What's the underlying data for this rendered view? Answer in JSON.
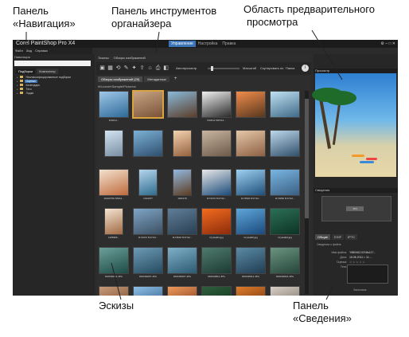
{
  "callouts": {
    "nav_panel": [
      "Панель",
      "«Навигация»"
    ],
    "organizer_toolbar": [
      "Панель инструментов",
      "органайзера"
    ],
    "preview_area": [
      "Область предварительного",
      "просмотра"
    ],
    "thumbnails": [
      "Эскизы"
    ],
    "info_panel": [
      "Панель",
      "«Сведения»"
    ]
  },
  "app": {
    "title": "Corel PaintShop Pro X4",
    "mode_tabs": [
      "Управление",
      "Настройка",
      "Правка"
    ],
    "active_mode": "Управление",
    "menu": [
      "Файл",
      "Вид",
      "Справка"
    ],
    "nav_panel": {
      "header": "Навигация",
      "search_placeholder": "",
      "tabs": [
        "Подборки",
        "Компьютер"
      ],
      "tree": [
        {
          "label": "Неклассифицированные подборки",
          "selected": false
        },
        {
          "label": "Оценки",
          "selected": true
        },
        {
          "label": "Календарь",
          "selected": false
        },
        {
          "label": "Теги",
          "selected": false
        },
        {
          "label": "Лодки",
          "selected": false
        }
      ]
    },
    "center": {
      "top_tabs": [
        "Эскизы",
        "Обзоры изображений"
      ],
      "toolbar": {
        "autopreview_label": "Автопросмотр",
        "size_label": "Масштаб",
        "sort_label": "Сортировать по",
        "sort_value": "Папка"
      },
      "doc_tabs": [
        "Обзоры изображений (29)",
        "Метаданные"
      ],
      "path": "\\b\\Leonie\\Sample\\Pictures\\",
      "thumbs": [
        {
          "cap": "4/30/14...",
          "colors": [
            "#9fc7e8",
            "#2e6a98"
          ],
          "portrait": false,
          "sel": false
        },
        {
          "cap": "",
          "colors": [
            "#c7a585",
            "#7a5236"
          ],
          "portrait": false,
          "sel": true
        },
        {
          "cap": "",
          "colors": [
            "#89b9d9",
            "#5b3d2a"
          ],
          "portrait": false,
          "sel": false
        },
        {
          "cap": "5/03/11 5/05/14...",
          "colors": [
            "#f0f0f0",
            "#2a2a2a"
          ],
          "portrait": false,
          "sel": false
        },
        {
          "cap": "",
          "colors": [
            "#f28c4b",
            "#57371e"
          ],
          "portrait": false,
          "sel": false
        },
        {
          "cap": "",
          "colors": [
            "#bfe2f2",
            "#406a89"
          ],
          "portrait": false,
          "sel": false
        },
        {
          "cap": "",
          "colors": [
            "#d3e4f1",
            "#7a8fa4"
          ],
          "portrait": true,
          "sel": false
        },
        {
          "cap": "",
          "colors": [
            "#7cb1d7",
            "#2e4e6d"
          ],
          "portrait": false,
          "sel": false
        },
        {
          "cap": "",
          "colors": [
            "#f3d2b0",
            "#95623e"
          ],
          "portrait": true,
          "sel": false
        },
        {
          "cap": "",
          "colors": [
            "#c9b5a0",
            "#6c5a4a"
          ],
          "portrait": false,
          "sel": false
        },
        {
          "cap": "",
          "colors": [
            "#e5c8a9",
            "#8d5f42"
          ],
          "portrait": false,
          "sel": false
        },
        {
          "cap": "",
          "colors": [
            "#bdd8ea",
            "#324f6c"
          ],
          "portrait": false,
          "sel": false
        },
        {
          "cap": "1610276S 5/9/12...",
          "colors": [
            "#f3e2cf",
            "#bf6a3c"
          ],
          "portrait": false,
          "sel": false
        },
        {
          "cap": "1313077",
          "colors": [
            "#b5d6ef",
            "#2f6b8c"
          ],
          "portrait": true,
          "sel": false
        },
        {
          "cap": "1181178",
          "colors": [
            "#93b8df",
            "#5c3d22"
          ],
          "portrait": true,
          "sel": false
        },
        {
          "cap": "1174372 5/17/12...",
          "colors": [
            "#e8e8e8",
            "#1b4b7a"
          ],
          "portrait": false,
          "sel": false
        },
        {
          "cap": "1174532 5/17/12...",
          "colors": [
            "#9dd0f1",
            "#1f4f79"
          ],
          "portrait": false,
          "sel": false
        },
        {
          "cap": "1174952 5/17/12...",
          "colors": [
            "#79b6e3",
            "#3b5f82"
          ],
          "portrait": false,
          "sel": false
        },
        {
          "cap": "1165995...",
          "colors": [
            "#f4e4d2",
            "#a06a42"
          ],
          "portrait": true,
          "sel": false
        },
        {
          "cap": "1174372 5/17/12...",
          "colors": [
            "#7fa5c7",
            "#3b4f61"
          ],
          "portrait": false,
          "sel": false
        },
        {
          "cap": "1174522 5/17/12...",
          "colors": [
            "#5f7e98",
            "#2a3f52"
          ],
          "portrait": false,
          "sel": false
        },
        {
          "cap": "Crystal01.jpg",
          "colors": [
            "#f36c1f",
            "#8c2b0c"
          ],
          "portrait": false,
          "sel": false
        },
        {
          "cap": "Crystal02.jpg",
          "colors": [
            "#5ea6d9",
            "#1b4a7c"
          ],
          "portrait": false,
          "sel": false
        },
        {
          "cap": "Crystal04.jpg",
          "colors": [
            "#2c6f56",
            "#0d3325"
          ],
          "portrait": false,
          "sel": false
        },
        {
          "cap": "DMC00001.JPG",
          "colors": [
            "#6aa09a",
            "#1f4b46"
          ],
          "portrait": false,
          "sel": false
        },
        {
          "cap": "DMC00007.JPG",
          "colors": [
            "#6f9bb6",
            "#234a5f"
          ],
          "portrait": false,
          "sel": false
        },
        {
          "cap": "DMC00007.JPG",
          "colors": [
            "#7fb0c9",
            "#2b5a71"
          ],
          "portrait": false,
          "sel": false
        },
        {
          "cap": "DMC00011.JPG",
          "colors": [
            "#4f7b6e",
            "#1d3a32"
          ],
          "portrait": false,
          "sel": false
        },
        {
          "cap": "DMC00012.JPG",
          "colors": [
            "#5b8aa5",
            "#203d52"
          ],
          "portrait": false,
          "sel": false
        },
        {
          "cap": "DMC00016.JPG",
          "colors": [
            "#6b9480",
            "#25453a"
          ],
          "portrait": false,
          "sel": false
        },
        {
          "cap": "",
          "colors": [
            "#c89a76",
            "#6a3e25"
          ],
          "portrait": false,
          "sel": false
        },
        {
          "cap": "",
          "colors": [
            "#8fc0e6",
            "#1e4c7a"
          ],
          "portrait": false,
          "sel": false
        },
        {
          "cap": "",
          "colors": [
            "#f09a5a",
            "#6a2a10"
          ],
          "portrait": false,
          "sel": false
        },
        {
          "cap": "",
          "colors": [
            "#2d5f3c",
            "#0f2b1a"
          ],
          "portrait": false,
          "sel": false
        },
        {
          "cap": "",
          "colors": [
            "#e07b2a",
            "#5a2a0c"
          ],
          "portrait": false,
          "sel": false
        },
        {
          "cap": "",
          "colors": [
            "#d8d0c8",
            "#6b5f54"
          ],
          "portrait": false,
          "sel": false
        }
      ]
    },
    "right": {
      "preview_header": "Просмотр",
      "navigator_header": "Сведения",
      "navigator_box": "JPG",
      "info_tabs": [
        "Общие",
        "EXIF",
        "IPTC"
      ],
      "active_info_tab": "Общие",
      "info_section": "Сведения о файле",
      "info_rows": [
        {
          "k": "Имя файла:",
          "v": "Y880462-02Ч6к117..."
        },
        {
          "k": "Дата:",
          "v": "16.06.2011 г. 11:..."
        },
        {
          "k": "Оценка:",
          "v": "☆☆☆☆☆"
        },
        {
          "k": "Теги:",
          "v": "Введите здесь..."
        }
      ],
      "bottom_label": "Заголовок"
    }
  },
  "colors": {
    "accent": "#3b74b7",
    "app_bg": "#2b2b2b",
    "selection": "#d9a440"
  }
}
